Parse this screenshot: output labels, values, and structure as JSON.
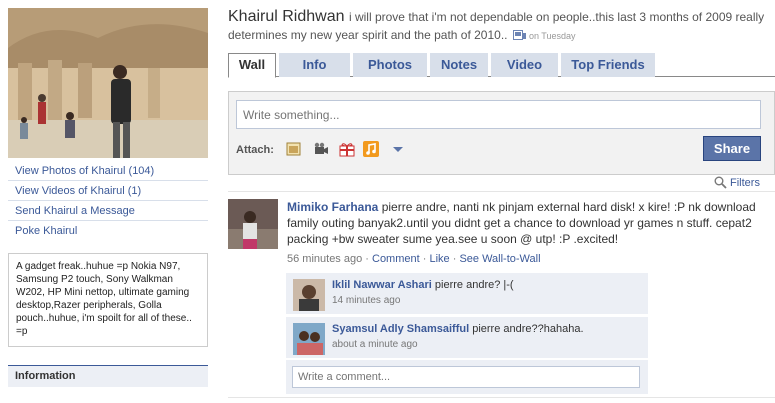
{
  "profile": {
    "name": "Khairul Ridhwan",
    "status": "i will prove that i'm not dependable on people..this last 3 months of 2009 really determines my new year spirit and the path of 2010..",
    "status_time": "on Tuesday"
  },
  "sidebar": {
    "links": [
      {
        "label": "View Photos of Khairul (104)"
      },
      {
        "label": "View Videos of Khairul (1)"
      },
      {
        "label": "Send Khairul a Message"
      },
      {
        "label": "Poke Khairul"
      }
    ],
    "bio": "A gadget freak..huhue =p Nokia N97, Samsung P2 touch, Sony Walkman W202, HP Mini nettop, ultimate gaming desktop,Razer peripherals, Golla pouch..huhue, i'm spoilt for all of these.. =p",
    "info_heading": "Information"
  },
  "tabs": [
    {
      "label": "Wall",
      "active": true
    },
    {
      "label": "Info",
      "active": false
    },
    {
      "label": "Photos",
      "active": false
    },
    {
      "label": "Notes",
      "active": false
    },
    {
      "label": "Video",
      "active": false
    },
    {
      "label": "Top Friends",
      "active": false
    }
  ],
  "publisher": {
    "placeholder": "Write something...",
    "attach_label": "Attach:",
    "attach_icons": [
      "photo-icon",
      "video-icon",
      "gift-icon",
      "music-icon",
      "more-dropdown-icon"
    ],
    "share_label": "Share"
  },
  "filters_label": "Filters",
  "post": {
    "author": "Mimiko Farhana",
    "text": "pierre andre, nanti nk pinjam external hard disk! x kire! :P nk download family outing banyak2.until you didnt get a chance to download yr games n stuff. cepat2 packing +bw sweater sume yea.see u soon @ utp! :P .excited!",
    "time": "56 minutes ago",
    "separator": " · ",
    "actions": [
      "Comment",
      "Like",
      "See Wall-to-Wall"
    ]
  },
  "comments": [
    {
      "author": "Iklil Nawwar Ashari",
      "text": "pierre andre? |-(",
      "time": "14 minutes ago"
    },
    {
      "author": "Syamsul Adly Shamsaifful",
      "text": "pierre andre??hahaha.",
      "time": "about a minute ago"
    }
  ],
  "comment_placeholder": "Write a comment...",
  "colors": {
    "link": "#3b5998",
    "tab_bg": "#d8dfea",
    "comment_bg": "#eceff5",
    "share_btn": "#5b74a8"
  }
}
